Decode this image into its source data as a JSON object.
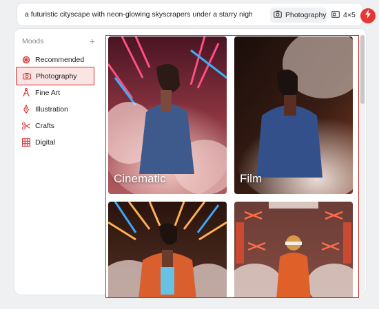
{
  "prompt": {
    "text": "a futuristic cityscape with neon-glowing skyscrapers under a starry night sky",
    "style_chip": "Photography",
    "ratio": "4×5"
  },
  "sidebar": {
    "title": "Moods",
    "add_symbol": "+",
    "items": [
      {
        "label": "Recommended",
        "icon": "sparkle-icon"
      },
      {
        "label": "Photography",
        "icon": "camera-icon",
        "active": true
      },
      {
        "label": "Fine Art",
        "icon": "compass-icon"
      },
      {
        "label": "Illustration",
        "icon": "pen-nib-icon"
      },
      {
        "label": "Crafts",
        "icon": "scissors-icon"
      },
      {
        "label": "Digital",
        "icon": "grid-icon"
      }
    ]
  },
  "gallery": {
    "cards": [
      {
        "label": "Cinematic",
        "image": "person-in-smoke-neon-pink"
      },
      {
        "label": "Film",
        "image": "person-in-smoke-dark-orange"
      },
      {
        "label": "",
        "image": "person-neon-orange-jacket"
      },
      {
        "label": "",
        "image": "person-orange-jumpsuit-room"
      }
    ]
  },
  "colors": {
    "accent": "#e53534",
    "highlight_border": "#d42a2a"
  }
}
